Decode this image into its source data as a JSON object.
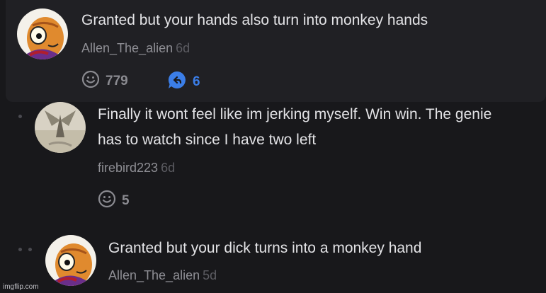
{
  "comments": [
    {
      "text": "Granted but your hands also turn into monkey hands",
      "author": "Allen_The_alien",
      "time": "6d",
      "likes": "779",
      "replies": "6"
    },
    {
      "text_line1": "Finally it wont feel like im jerking myself. Win win. The genie",
      "text_line2": "has to watch since I have two left",
      "author": "firebird223",
      "time": "6d",
      "likes": "5"
    },
    {
      "text": "Granted but your dick turns into a monkey hand",
      "author": "Allen_The_alien",
      "time": "5d"
    }
  ],
  "watermark": "imgflip.com",
  "colors": {
    "background": "#18181b",
    "highlight_card": "#202024",
    "reply_accent": "#3b7ee8",
    "muted_text": "#8e8e94"
  },
  "icons": [
    "smiley-icon",
    "reply-bubble-icon"
  ]
}
